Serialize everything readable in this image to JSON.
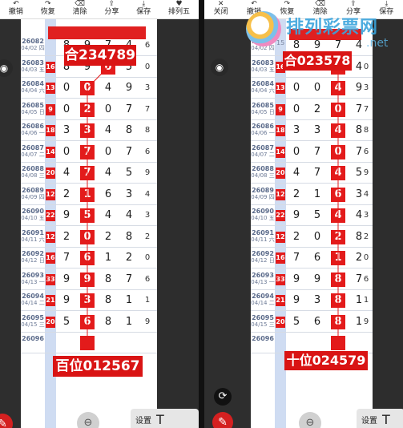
{
  "toolbar_left": [
    {
      "icon": "↶",
      "label": "撤销"
    },
    {
      "icon": "↷",
      "label": "恢复"
    },
    {
      "icon": "⌫",
      "label": "清除"
    },
    {
      "icon": "⇪",
      "label": "分享"
    },
    {
      "icon": "⤓",
      "label": "保存"
    },
    {
      "icon": "♥",
      "label": "排列五"
    }
  ],
  "toolbar_right": [
    {
      "icon": "✕",
      "label": "关闭"
    },
    {
      "icon": "↶",
      "label": "撤销"
    },
    {
      "icon": "↷",
      "label": "恢复"
    },
    {
      "icon": "⌫",
      "label": "清除"
    },
    {
      "icon": "⇪",
      "label": "分享"
    },
    {
      "icon": "⤓",
      "label": "保存"
    }
  ],
  "left_panel": {
    "sum_badge": "合234789",
    "position_badge": "百位012567",
    "rows": [
      {
        "issue": "26082",
        "date": "04/02 四",
        "sum": "",
        "d": [
          "8",
          "9",
          "7",
          "4"
        ],
        "last": "6",
        "hl": -1
      },
      {
        "issue": "26083",
        "date": "04/03 五",
        "sum": "16",
        "d": [
          "8",
          "9",
          "0",
          "5"
        ],
        "last": "0",
        "hl": 2
      },
      {
        "issue": "26084",
        "date": "04/04 六",
        "sum": "13",
        "d": [
          "0",
          "0",
          "4",
          "9"
        ],
        "last": "3",
        "hl": 1
      },
      {
        "issue": "26085",
        "date": "04/05 日",
        "sum": "9",
        "d": [
          "0",
          "2",
          "0",
          "7"
        ],
        "last": "7",
        "hl": 1
      },
      {
        "issue": "26086",
        "date": "04/06 一",
        "sum": "18",
        "d": [
          "3",
          "3",
          "4",
          "8"
        ],
        "last": "8",
        "hl": 1
      },
      {
        "issue": "26087",
        "date": "04/07 二",
        "sum": "14",
        "d": [
          "0",
          "7",
          "0",
          "7"
        ],
        "last": "6",
        "hl": 1
      },
      {
        "issue": "26088",
        "date": "04/08 三",
        "sum": "20",
        "d": [
          "4",
          "7",
          "4",
          "5"
        ],
        "last": "9",
        "hl": 1
      },
      {
        "issue": "26089",
        "date": "04/09 四",
        "sum": "12",
        "d": [
          "2",
          "1",
          "6",
          "3"
        ],
        "last": "4",
        "hl": 1
      },
      {
        "issue": "26090",
        "date": "04/10 五",
        "sum": "22",
        "d": [
          "9",
          "5",
          "4",
          "4"
        ],
        "last": "3",
        "hl": 1
      },
      {
        "issue": "26091",
        "date": "04/11 六",
        "sum": "12",
        "d": [
          "2",
          "0",
          "2",
          "8"
        ],
        "last": "2",
        "hl": 1
      },
      {
        "issue": "26092",
        "date": "04/12 日",
        "sum": "16",
        "d": [
          "7",
          "6",
          "1",
          "2"
        ],
        "last": "0",
        "hl": 1
      },
      {
        "issue": "26093",
        "date": "04/13 一",
        "sum": "33",
        "d": [
          "9",
          "9",
          "8",
          "7"
        ],
        "last": "6",
        "hl": 1
      },
      {
        "issue": "26094",
        "date": "04/14 二",
        "sum": "21",
        "d": [
          "9",
          "3",
          "8",
          "1"
        ],
        "last": "1",
        "hl": 1
      },
      {
        "issue": "26095",
        "date": "04/15 三",
        "sum": "20",
        "d": [
          "5",
          "6",
          "8",
          "1"
        ],
        "last": "9",
        "hl": 1
      },
      {
        "issue": "26096",
        "date": "",
        "sum": "",
        "d": [
          "",
          "",
          "",
          ""
        ],
        "last": "",
        "hl": 1
      }
    ]
  },
  "right_panel": {
    "sum_badge": "合023578",
    "position_badge": "十位024579",
    "rows": [
      {
        "issue": "26082",
        "date": "04/02 四",
        "sum": "15",
        "d": [
          "8",
          "9",
          "7",
          "4"
        ],
        "last": "",
        "hl": -1
      },
      {
        "issue": "26083",
        "date": "04/03 五",
        "sum": "16",
        "d": [
          "9",
          "0",
          "3",
          "4"
        ],
        "last": "0",
        "hl": 2
      },
      {
        "issue": "26084",
        "date": "04/04 六",
        "sum": "13",
        "d": [
          "0",
          "0",
          "4",
          "9"
        ],
        "last": "3",
        "hl": 2
      },
      {
        "issue": "26085",
        "date": "04/05 日",
        "sum": "9",
        "d": [
          "0",
          "2",
          "0",
          "7"
        ],
        "last": "7",
        "hl": 2
      },
      {
        "issue": "26086",
        "date": "04/06 一",
        "sum": "18",
        "d": [
          "3",
          "3",
          "4",
          "8"
        ],
        "last": "8",
        "hl": 2
      },
      {
        "issue": "26087",
        "date": "04/07 二",
        "sum": "14",
        "d": [
          "0",
          "7",
          "0",
          "7"
        ],
        "last": "6",
        "hl": 2
      },
      {
        "issue": "26088",
        "date": "04/08 三",
        "sum": "20",
        "d": [
          "4",
          "7",
          "4",
          "5"
        ],
        "last": "9",
        "hl": 2
      },
      {
        "issue": "26089",
        "date": "04/09 四",
        "sum": "12",
        "d": [
          "2",
          "1",
          "6",
          "3"
        ],
        "last": "4",
        "hl": 2
      },
      {
        "issue": "26090",
        "date": "04/10 五",
        "sum": "22",
        "d": [
          "9",
          "5",
          "4",
          "4"
        ],
        "last": "3",
        "hl": 2
      },
      {
        "issue": "26091",
        "date": "04/11 六",
        "sum": "12",
        "d": [
          "2",
          "0",
          "2",
          "8"
        ],
        "last": "2",
        "hl": 2
      },
      {
        "issue": "26092",
        "date": "04/12 日",
        "sum": "16",
        "d": [
          "7",
          "6",
          "1",
          "2"
        ],
        "last": "0",
        "hl": 2
      },
      {
        "issue": "26093",
        "date": "04/13 一",
        "sum": "33",
        "d": [
          "9",
          "9",
          "8",
          "7"
        ],
        "last": "6",
        "hl": 2
      },
      {
        "issue": "26094",
        "date": "04/14 二",
        "sum": "21",
        "d": [
          "9",
          "3",
          "8",
          "1"
        ],
        "last": "1",
        "hl": 2
      },
      {
        "issue": "26095",
        "date": "04/15 三",
        "sum": "20",
        "d": [
          "5",
          "6",
          "8",
          "1"
        ],
        "last": "9",
        "hl": 2
      },
      {
        "issue": "26096",
        "date": "",
        "sum": "",
        "d": [
          "",
          "",
          "",
          ""
        ],
        "last": "",
        "hl": 2
      }
    ]
  },
  "bottom": {
    "settings": "设置",
    "text_tool": "T"
  },
  "watermark": {
    "logo_text": "排列彩票网",
    "url": ".net"
  },
  "colors": {
    "accent_red": "#e31b1b",
    "grid_blue": "#cfdcf2"
  }
}
